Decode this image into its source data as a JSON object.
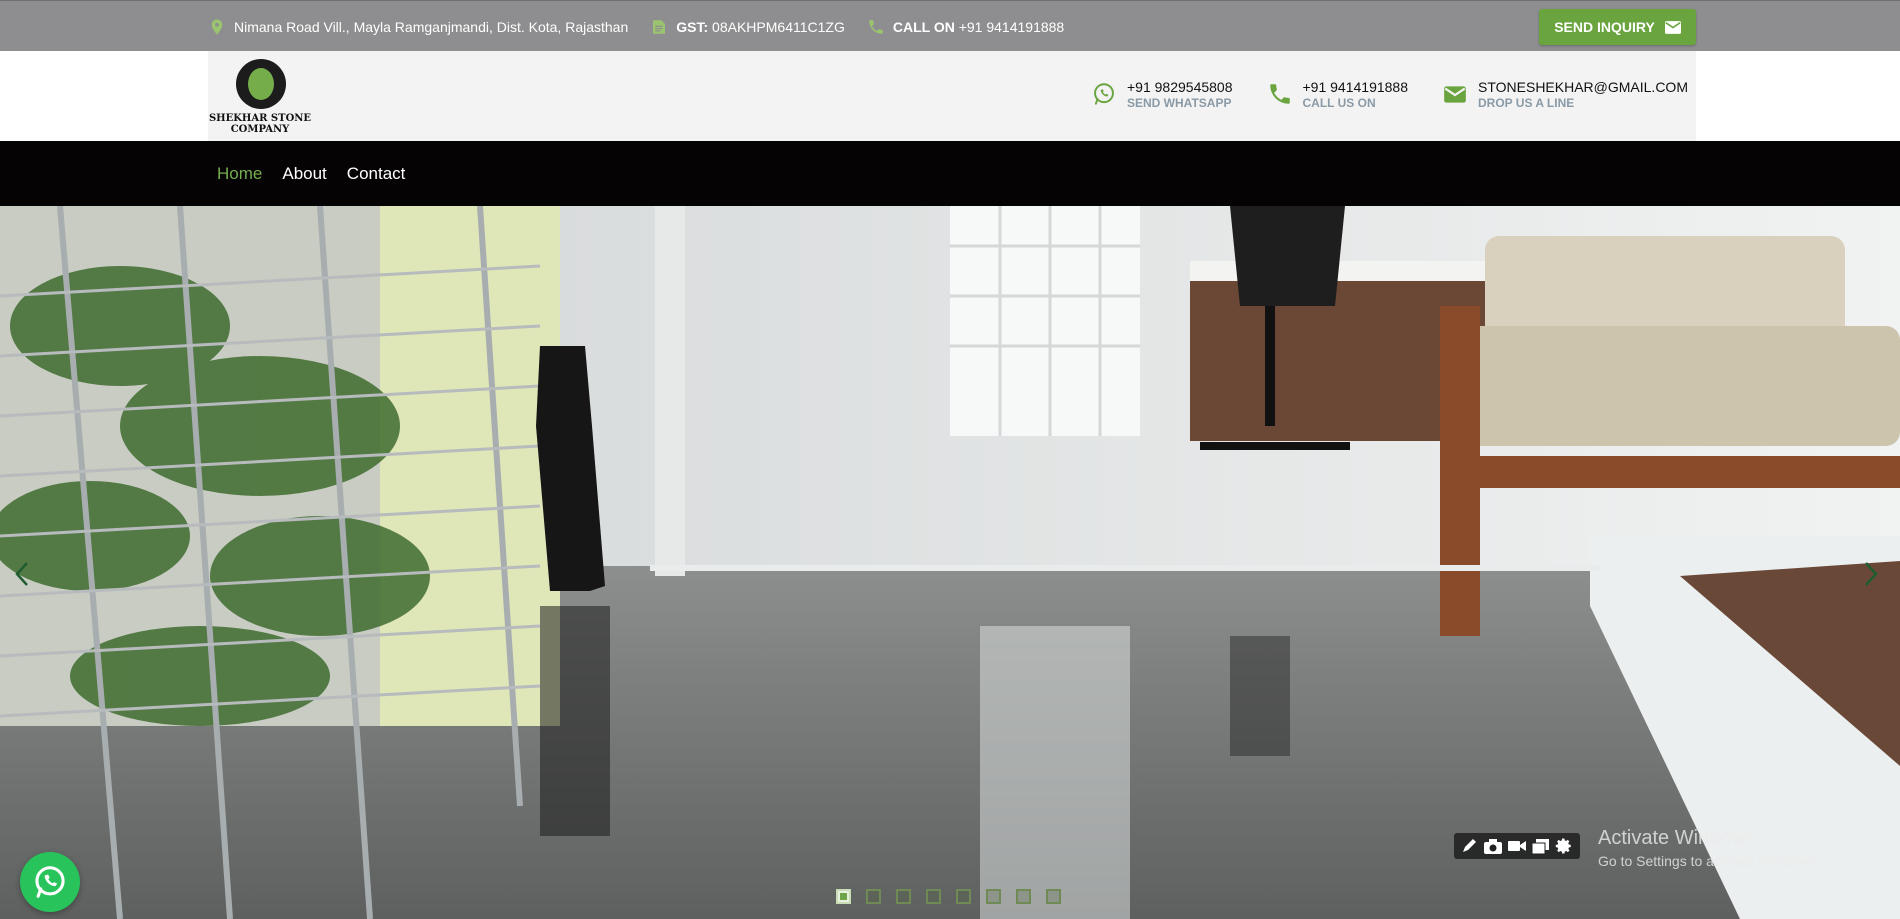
{
  "topbar": {
    "address": "Nimana Road Vill., Mayla Ramganjmandi, Dist. Kota, Rajasthan",
    "gst_label": "GST:",
    "gst_value": "08AKHPM6411C1ZG",
    "call_label": "CALL ON",
    "call_value": "+91 9414191888",
    "inquiry_label": "SEND INQUIRY",
    "icons": [
      "location-pin-icon",
      "document-icon",
      "phone-icon",
      "mail-icon"
    ],
    "background": "#8e8e90",
    "accent": "#6aa43f"
  },
  "header": {
    "logo_text_line1": "SHEKHAR STONE",
    "logo_text_line2": "COMPANY",
    "contacts": [
      {
        "value": "+91 9829545808",
        "label": "SEND WHATSAPP",
        "icon": "whatsapp-icon"
      },
      {
        "value": "+91 9414191888",
        "label": "CALL US ON",
        "icon": "phone-icon"
      },
      {
        "value": "STONESHEKHAR@GMAIL.COM",
        "label": "DROP US A LINE",
        "icon": "mail-icon"
      }
    ]
  },
  "nav": {
    "items": [
      {
        "label": "Home",
        "active": true
      },
      {
        "label": "About",
        "active": false
      },
      {
        "label": "Contact",
        "active": false
      }
    ],
    "active_color": "#75ad4e"
  },
  "hero": {
    "slide_count": 8,
    "active_slide": 1,
    "prev_icon": "chevron-left-icon",
    "next_icon": "chevron-right-icon"
  },
  "overlay": {
    "activate_title": "Activate Windows",
    "activate_subtitle": "Go to Settings to activate Windows.",
    "toolbar_icons": [
      "pen-icon",
      "camera-icon",
      "video-icon",
      "window-icon",
      "gear-icon"
    ]
  }
}
